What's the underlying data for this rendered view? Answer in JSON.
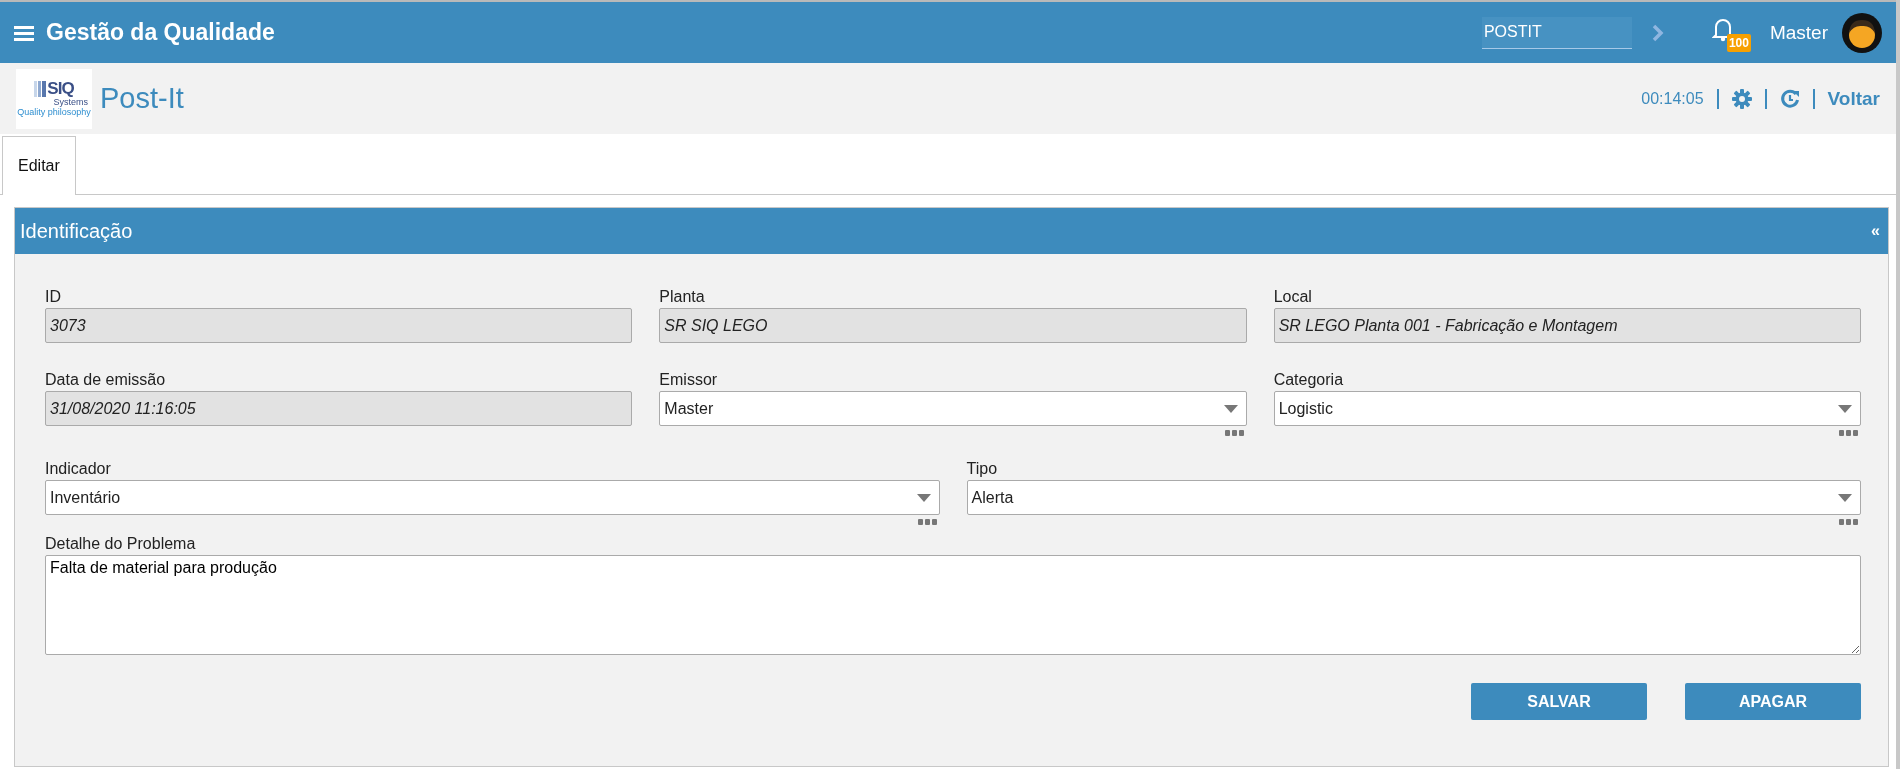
{
  "top_bar": {
    "title": "Gestão da Qualidade",
    "search": {
      "value": "POSTIT"
    },
    "notifications": {
      "count": "100"
    },
    "user": "Master"
  },
  "header": {
    "logo": {
      "name": "SIQ",
      "subname": "Systems",
      "tagline": "Quality philosophy"
    },
    "title": "Post-It",
    "timer": "00:14:05",
    "back_link": "Voltar"
  },
  "tabs": [
    {
      "label": "Editar",
      "selected": true
    }
  ],
  "panel": {
    "title": "Identificação",
    "collapse": "«",
    "rows": [
      [
        {
          "label": "ID",
          "value": "3073",
          "kind": "readonly"
        },
        {
          "label": "Planta",
          "value": "SR SIQ LEGO",
          "kind": "readonly"
        },
        {
          "label": "Local",
          "value": "SR LEGO Planta 001 - Fabricação e Montagem",
          "kind": "readonly"
        }
      ],
      [
        {
          "label": "Data de emissão",
          "value": "31/08/2020 11:16:05",
          "kind": "readonly"
        },
        {
          "label": "Emissor",
          "value": "Master",
          "kind": "select"
        },
        {
          "label": "Categoria",
          "value": "Logistic",
          "kind": "select"
        }
      ],
      [
        {
          "label": "Indicador",
          "value": "Inventário",
          "kind": "select"
        },
        {
          "label": "Tipo",
          "value": "Alerta",
          "kind": "select"
        }
      ],
      [
        {
          "label": "Detalhe do Problema",
          "value": "Falta de material para produção",
          "kind": "textarea"
        }
      ]
    ],
    "buttons": [
      "SALVAR",
      "APAGAR"
    ]
  }
}
